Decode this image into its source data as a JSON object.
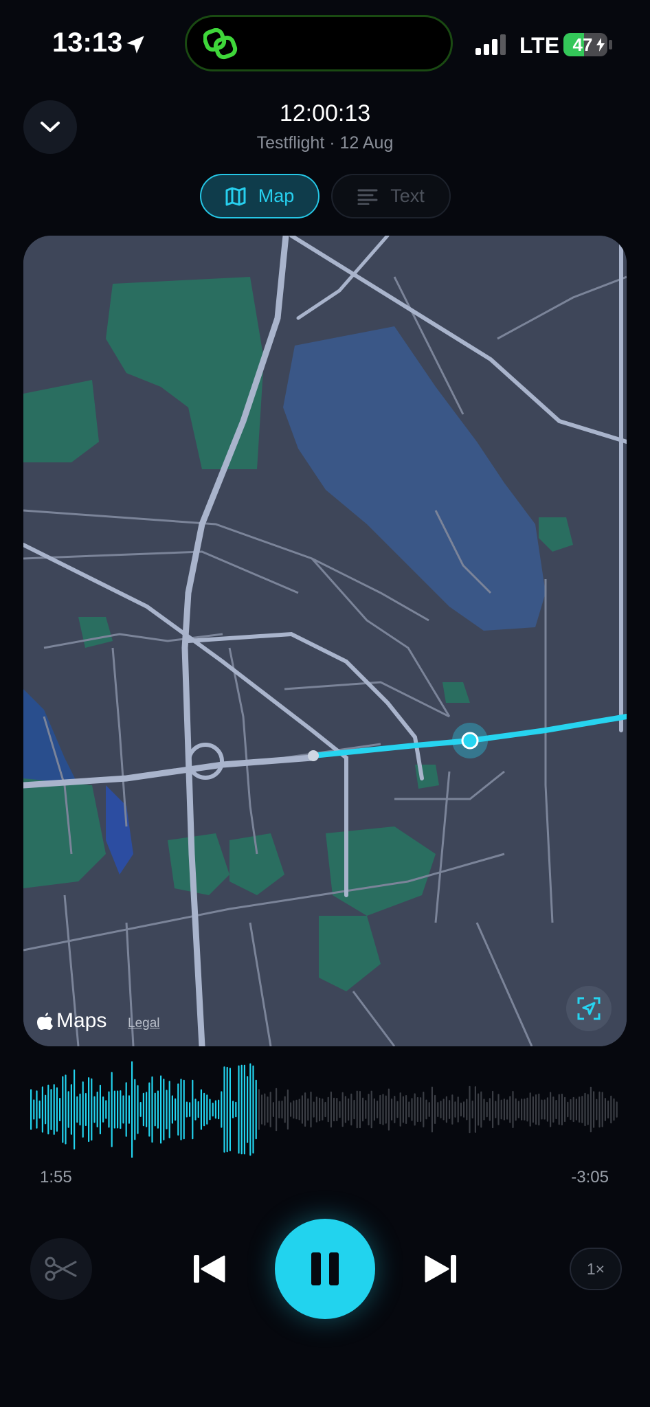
{
  "status_bar": {
    "time": "13:13",
    "network": "LTE",
    "battery_percent": "47",
    "battery_level": 0.47,
    "icons": [
      "location-arrow-icon",
      "app-link-icon",
      "cellular-signal-icon",
      "battery-charging-icon"
    ]
  },
  "header": {
    "title": "12:00:13",
    "subtitle": "Testflight · 12 Aug",
    "collapse_icon": "chevron-down-icon"
  },
  "tabs": [
    {
      "label": "Map",
      "icon": "map-icon",
      "selected": true
    },
    {
      "label": "Text",
      "icon": "text-lines-icon",
      "selected": false
    }
  ],
  "map": {
    "brand": "Maps",
    "legal": "Legal",
    "recenter_icon": "locate-icon",
    "route_color": "#27d4f0"
  },
  "player": {
    "elapsed": "1:55",
    "remaining": "-3:05",
    "progress": 0.385,
    "speed": "1×",
    "controls": [
      "scissors-icon",
      "skip-back-icon",
      "pause-icon",
      "skip-forward-icon"
    ]
  },
  "colors": {
    "accent": "#22d3ee",
    "background": "#06080e"
  }
}
